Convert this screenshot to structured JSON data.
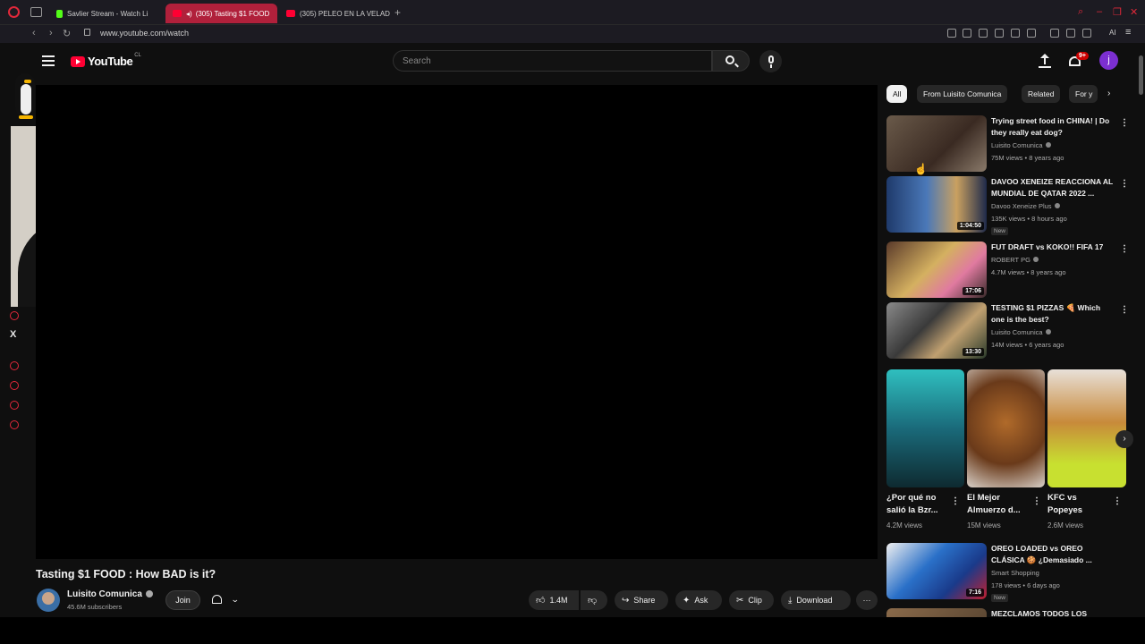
{
  "browser": {
    "tabs": [
      {
        "label": "Savlier Stream - Watch Li",
        "active": false
      },
      {
        "label": "(305) Tasting $1 FOOD",
        "active": true
      },
      {
        "label": "(305) PELEO EN LA VELAD",
        "active": false
      }
    ],
    "url": "www.youtube.com/watch",
    "ai_label": "AI"
  },
  "header": {
    "logo_text": "YouTube",
    "country_code": "CL",
    "search_placeholder": "Search",
    "notification_count": "9+",
    "avatar_letter": "j"
  },
  "video": {
    "title": "Tasting $1 FOOD : How BAD is it?",
    "channel": "Luisito Comunica",
    "subscribers": "45.6M subscribers",
    "join_label": "Join",
    "like_count": "1.4M",
    "share_label": "Share",
    "ask_label": "Ask",
    "clip_label": "Clip",
    "download_label": "Download"
  },
  "chips": [
    "All",
    "From Luisito Comunica",
    "Related",
    "For y"
  ],
  "recommendations": [
    {
      "title": "Trying street food in CHINA! | Do they really eat dog?",
      "channel": "Luisito Comunica",
      "meta": "75M views • 8 years ago",
      "duration": "",
      "new": ""
    },
    {
      "title": "DAVOO XENEIZE REACCIONA AL MUNDIAL DE QATAR 2022 ...",
      "channel": "Davoo Xeneize Plus",
      "meta": "135K views • 8 hours ago",
      "duration": "1:04:50",
      "new": "New"
    },
    {
      "title": "FUT DRAFT vs KOKO!! FIFA 17",
      "channel": "ROBERT PG",
      "meta": "4.7M views • 8 years ago",
      "duration": "17:06",
      "new": ""
    },
    {
      "title": "TESTING $1 PIZZAS 🍕 Which one is the best?",
      "channel": "Luisito Comunica",
      "meta": "14M views • 6 years ago",
      "duration": "13:30",
      "new": ""
    },
    {
      "title": "OREO LOADED vs OREO CLÁSICA 🍪 ¿Demasiado ...",
      "channel": "Smart Shopping",
      "meta": "178 views • 6 days ago",
      "duration": "7:16",
      "new": "New"
    },
    {
      "title": "MEZCLAMOS TODOS LOS",
      "channel": "",
      "meta": "",
      "duration": "",
      "new": ""
    }
  ],
  "shorts": [
    {
      "title": "¿Por qué no salió la Bzr...",
      "views": "4.2M views"
    },
    {
      "title": "El Mejor Almuerzo d...",
      "views": "15M views"
    },
    {
      "title": "KFC vs Popeyes",
      "views": "2.6M views"
    }
  ],
  "icons": {
    "like": "thumbs-up-icon",
    "dislike": "thumbs-down-icon",
    "share": "share-icon",
    "ask": "sparkle-icon",
    "clip": "scissors-icon",
    "download": "download-icon"
  },
  "colors": {
    "background": "#0f0f0f",
    "accent": "#ff0033",
    "active_tab": "#b0203b",
    "chip_bg": "#272727"
  }
}
